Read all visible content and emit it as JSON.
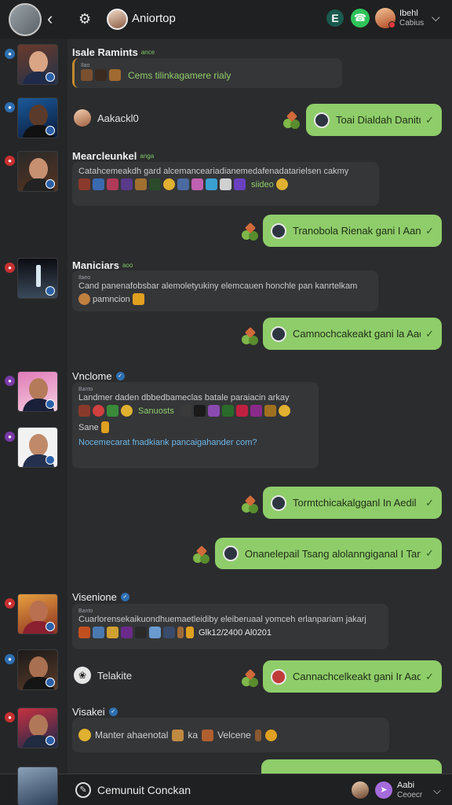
{
  "header": {
    "back_icon": "chevron-left-icon",
    "settings_icon": "gear-icon",
    "title": "Aniortop",
    "user_name": "Ibehl",
    "user_status": "Cabius",
    "menu_icon": "chevron-down-icon"
  },
  "messages": [
    {
      "type": "in",
      "sender": "Isale Ramints",
      "tag": "ance",
      "label": "Ilao",
      "text": "Cems tilinkagamere rialy"
    },
    {
      "type": "plain",
      "sender": "Aakackl0"
    },
    {
      "type": "out",
      "text": "Toai Dialdah Danitu"
    },
    {
      "type": "in",
      "sender": "Mearcleunkel",
      "tag": "anga",
      "text": "Catahcemeakdh gard alcemanceariadianemedafenadatarielsen cakmy",
      "emoji_tail": "siideo"
    },
    {
      "type": "out",
      "text": "Tranobola Rienak gani I Aandu"
    },
    {
      "type": "in",
      "sender": "Maniciars",
      "tag": "aoo",
      "label": "Ilaeo",
      "text": "Cand panenafobsbar alemoletyukiny elemcauen honchle pan kanrtelkam",
      "text2": "pamncion"
    },
    {
      "type": "out",
      "text": "Camnochcakeakt gani la Aadu"
    },
    {
      "type": "in",
      "sender": "Vnclome",
      "label": "Banto",
      "text": "Landmer daden dbbedbameclas batale paraiacin arkay",
      "emoji_mid": "Sanuosts",
      "text2": "Sane",
      "link": "Nocemecarat fnadkiank pancaigahander com?"
    },
    {
      "type": "out",
      "text": "Tormtchicakalgganl In Aedil"
    },
    {
      "type": "out",
      "text": "Onanelepail Tsang alolanngiganal I Tanda"
    },
    {
      "type": "in",
      "sender": "Visenione",
      "label": "Banto",
      "text": "Cuarlorensekaikuondhuemaetleidiby eleiberuaal yomceh erlanpariam jakarj",
      "emoji_tail": "Glk12/2400 Al0201"
    },
    {
      "type": "plain",
      "sender": "Telakite"
    },
    {
      "type": "out",
      "text": "Cannachcelkeakt gani Ir Aadu"
    },
    {
      "type": "in",
      "sender": "Visakei",
      "text": "Manter ahaenotal",
      "text2": "ka",
      "text3": "Velcene"
    }
  ],
  "footer": {
    "compose_label": "Cemunuit Conckan",
    "user_name": "Aabi",
    "user_status": "Ceoecr"
  },
  "colors": {
    "background": "#2b2c2e",
    "header": "#1f2021",
    "outgoing_bubble": "#8fcd6a",
    "incoming_bubble": "#353638",
    "link": "#6eb6e6"
  }
}
